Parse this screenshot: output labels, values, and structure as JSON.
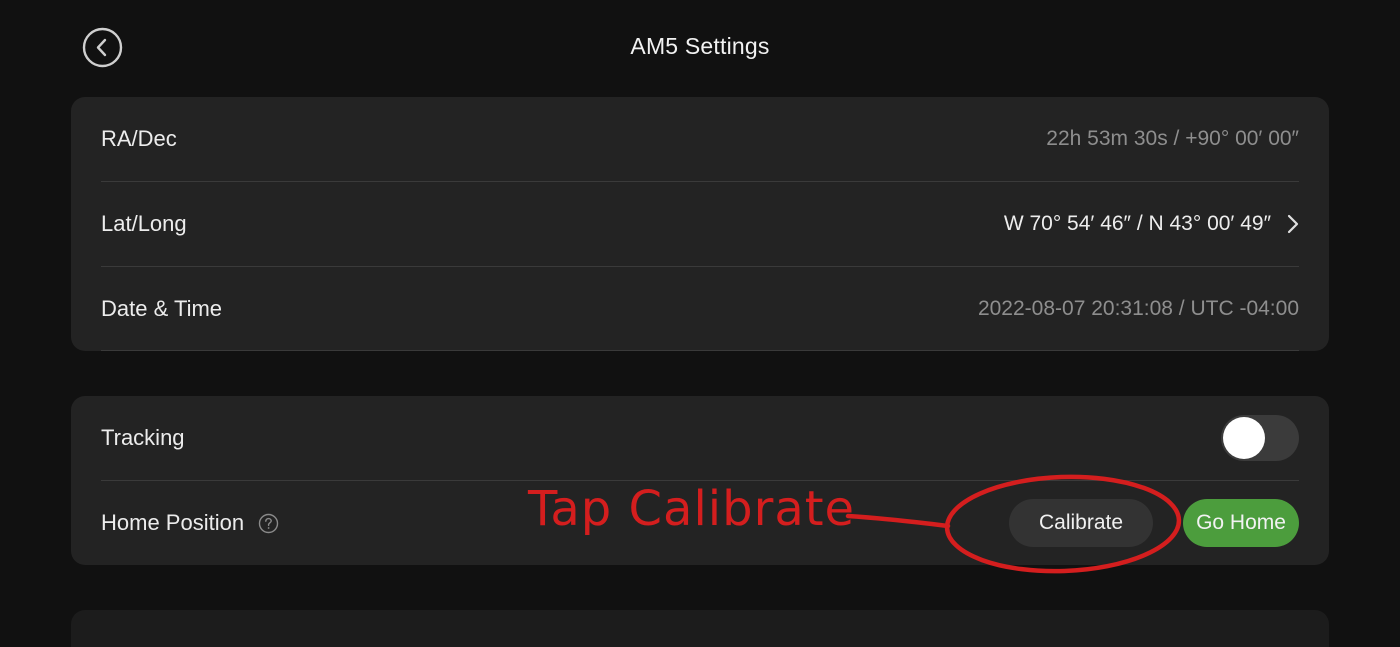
{
  "header": {
    "title": "AM5 Settings",
    "back_icon": "chevron-left-circle-icon"
  },
  "info": {
    "ra_dec_label": "RA/Dec",
    "ra_dec_value": "22h 53m 30s / +90° 00′ 00″",
    "lat_long_label": "Lat/Long",
    "lat_long_value": "W 70° 54′ 46″ / N 43° 00′ 49″",
    "date_time_label": "Date & Time",
    "date_time_value": "2022-08-07 20:31:08 / UTC -04:00"
  },
  "controls": {
    "tracking_label": "Tracking",
    "tracking_on": false,
    "home_position_label": "Home Position",
    "help_icon": "question-circle-icon",
    "calibrate_label": "Calibrate",
    "go_home_label": "Go Home"
  },
  "annotation": {
    "text": "Tap Calibrate",
    "color": "#d41e1e"
  },
  "colors": {
    "background": "#111111",
    "card": "#232323",
    "accent_green": "#4c9d3d",
    "secondary_text": "#8e8e8e"
  }
}
